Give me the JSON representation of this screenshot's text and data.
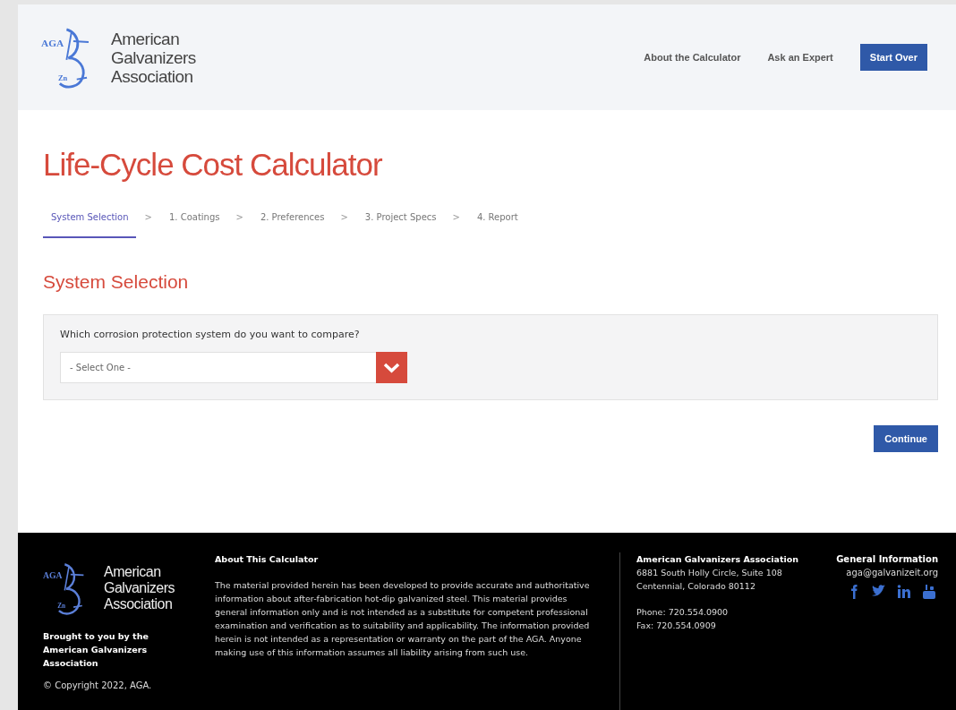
{
  "header": {
    "logo": {
      "badge_top": "AGA",
      "badge_bottom": "Zn",
      "name_lines": [
        "American",
        "Galvanizers",
        "Association"
      ]
    },
    "nav": [
      {
        "label": "About the Calculator",
        "kind": "link"
      },
      {
        "label": "Ask an Expert",
        "kind": "link"
      },
      {
        "label": "Start Over",
        "kind": "button"
      }
    ]
  },
  "page_title": "Life-Cycle Cost Calculator",
  "steps": [
    {
      "label": "System Selection",
      "separator": ">",
      "selected": true
    },
    {
      "label": "1. Coatings",
      "separator": ">",
      "selected": false
    },
    {
      "label": "2. Preferences",
      "separator": ">",
      "selected": false
    },
    {
      "label": "3. Project Specs",
      "separator": ">",
      "selected": false
    },
    {
      "label": "4. Report",
      "selected": false
    }
  ],
  "section_title": "System Selection",
  "question": {
    "label": "Which corrosion protection system do you want to compare?",
    "placeholder": "- Select One -"
  },
  "continue_button": "Continue",
  "footer": {
    "logo": {
      "badge_top": "AGA",
      "badge_bottom": "Zn",
      "name_lines": [
        "American",
        "Galvanizers",
        "Association"
      ]
    },
    "brought_by": "Brought to you by the American Galvanizers Association",
    "copyright": "© Copyright 2022, AGA.",
    "about": {
      "title": "About This Calculator",
      "text": "The material provided herein has been developed to provide accurate and authoritative information about after-fabrication hot-dip galvanized steel. This material provides general information only and is not intended as a substitute for competent professional examination and verification as to suitability and applicability. The information provided herein is not intended as a representation or warranty on the part of the AGA. Anyone making use of this information assumes all liability arising from such use."
    },
    "contact": {
      "title": "American Galvanizers Association",
      "address_lines": [
        "6881 South Holly Circle, Suite 108",
        "Centennial, Colorado 80112"
      ],
      "phone": "Phone: 720.554.0900",
      "fax": "Fax: 720.554.0909"
    },
    "general": {
      "title": "General Information",
      "email": "aga@galvanizeit.org",
      "social": [
        {
          "kind": "facebook"
        },
        {
          "kind": "twitter"
        },
        {
          "kind": "linkedin"
        },
        {
          "kind": "youtube"
        }
      ]
    }
  }
}
